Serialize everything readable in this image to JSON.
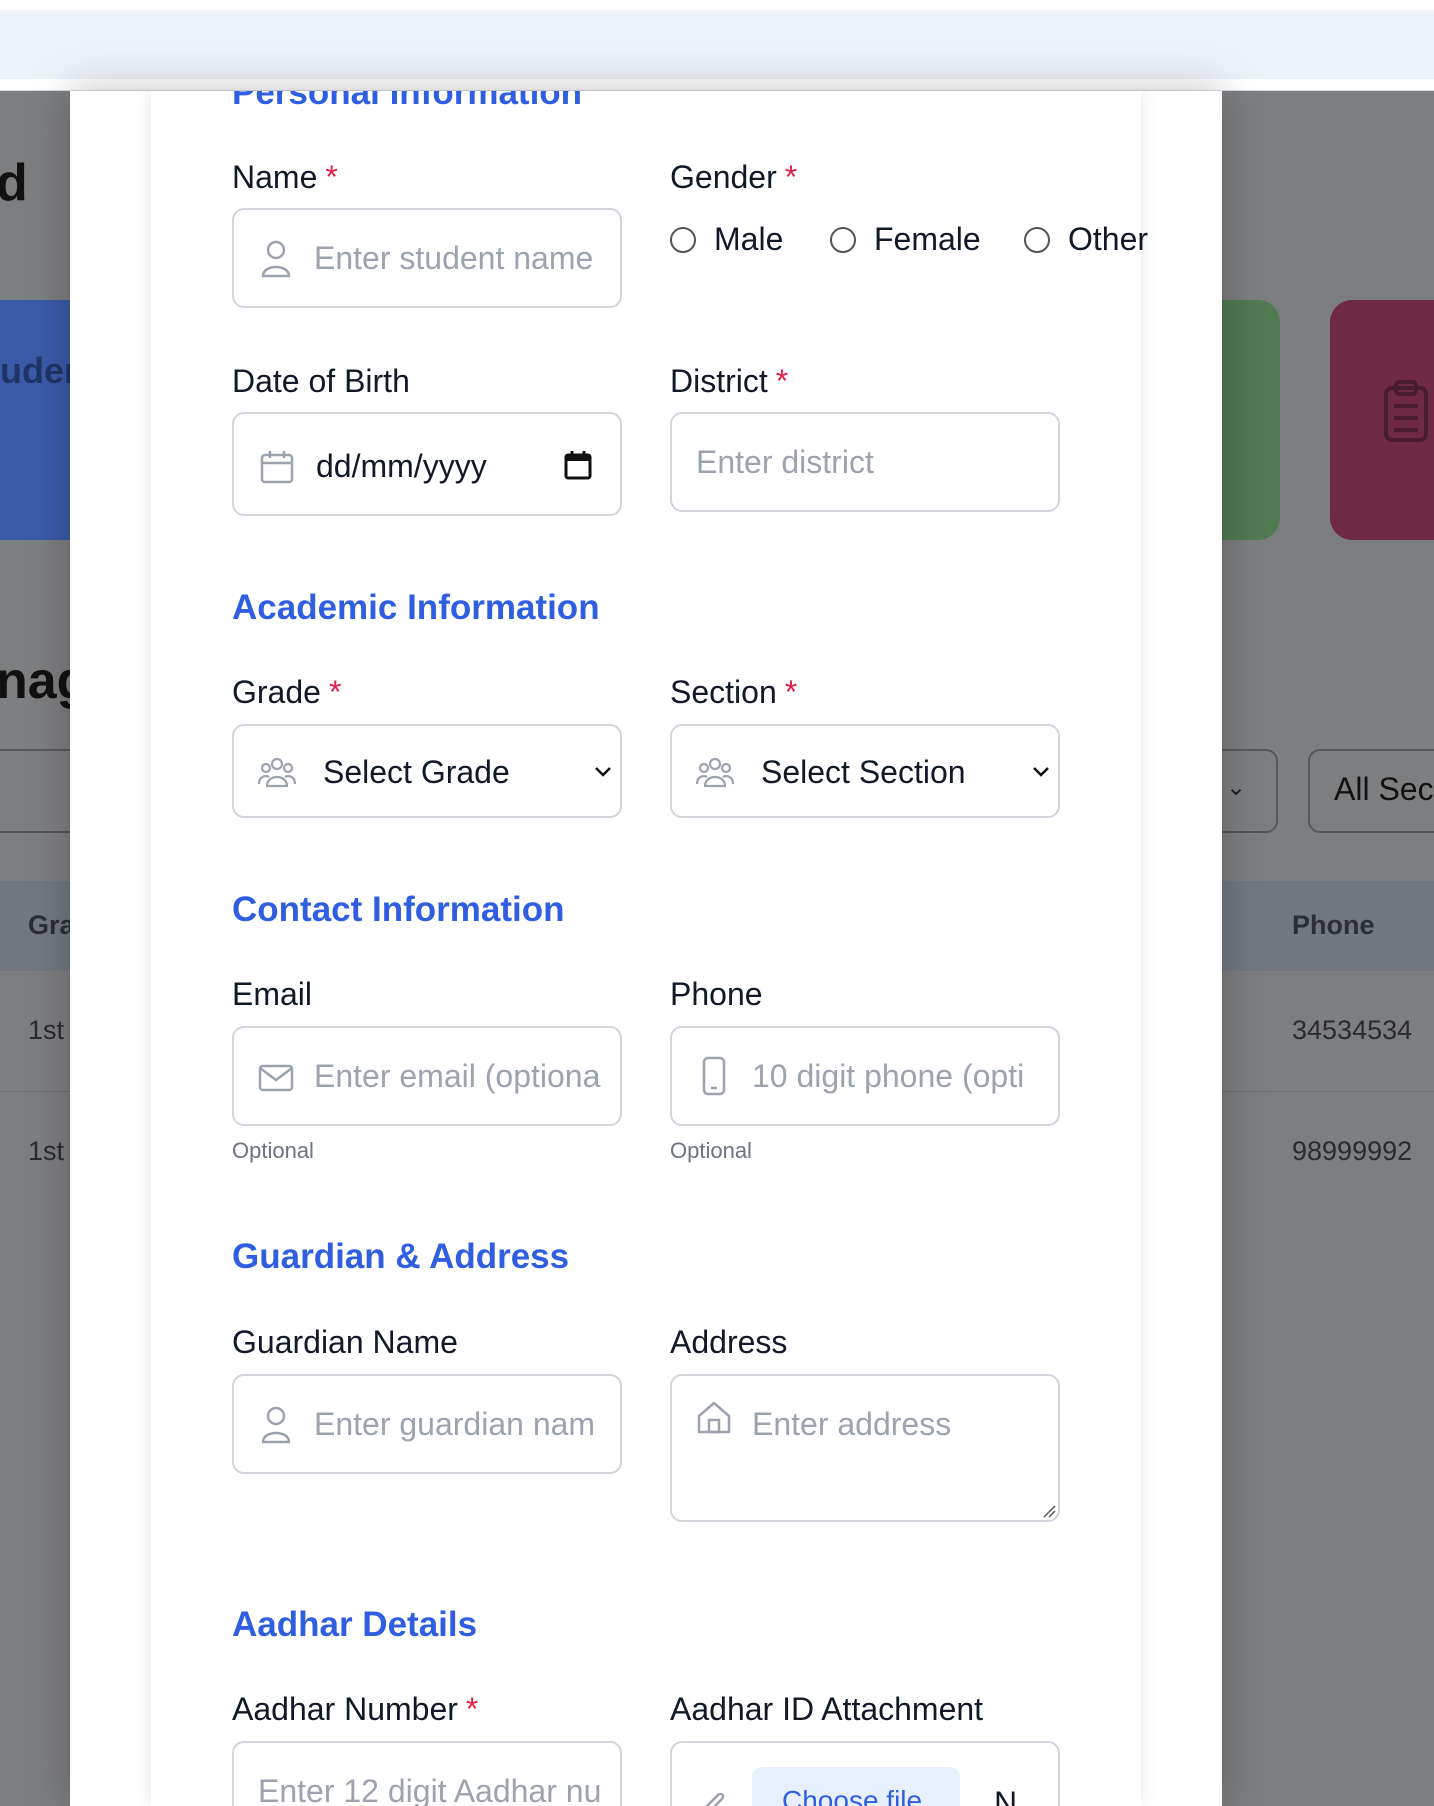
{
  "background": {
    "partial_title": "d",
    "partial_stat_label": "uder",
    "partial_section_title": "nag",
    "filter_select_partial": "All Sec",
    "table": {
      "headers": [
        "Gra",
        "Phone"
      ],
      "rows": [
        {
          "grade": "1st",
          "phone": "34534534"
        },
        {
          "grade": "1st",
          "phone": "98999992"
        }
      ]
    },
    "card_colors": [
      "#3b5ba9",
      "#4f7a52",
      "#6e2a44"
    ]
  },
  "form": {
    "personal": {
      "title": "Personal Information",
      "name_label": "Name",
      "name_placeholder": "Enter student name",
      "gender_label": "Gender",
      "gender_options": [
        "Male",
        "Female",
        "Other"
      ],
      "dob_label": "Date of Birth",
      "dob_value": "dd/mm/yyyy",
      "district_label": "District",
      "district_placeholder": "Enter district"
    },
    "academic": {
      "title": "Academic Information",
      "grade_label": "Grade",
      "grade_value": "Select Grade",
      "section_label": "Section",
      "section_value": "Select Section"
    },
    "contact": {
      "title": "Contact Information",
      "email_label": "Email",
      "email_placeholder": "Enter email (optiona",
      "email_hint": "Optional",
      "phone_label": "Phone",
      "phone_placeholder": "10 digit phone (opti",
      "phone_hint": "Optional"
    },
    "guardian": {
      "title": "Guardian & Address",
      "guardian_label": "Guardian Name",
      "guardian_placeholder": "Enter guardian nam",
      "address_label": "Address",
      "address_placeholder": "Enter address"
    },
    "aadhar": {
      "title": "Aadhar Details",
      "number_label": "Aadhar Number",
      "number_placeholder": "Enter 12 digit Aadhar nu",
      "attachment_label": "Aadhar ID Attachment",
      "choose_file": "Choose file",
      "no_file_partial": "N"
    },
    "required_mark": "*",
    "accent_color": "#2f5fe0",
    "required_color": "#e11d48"
  }
}
